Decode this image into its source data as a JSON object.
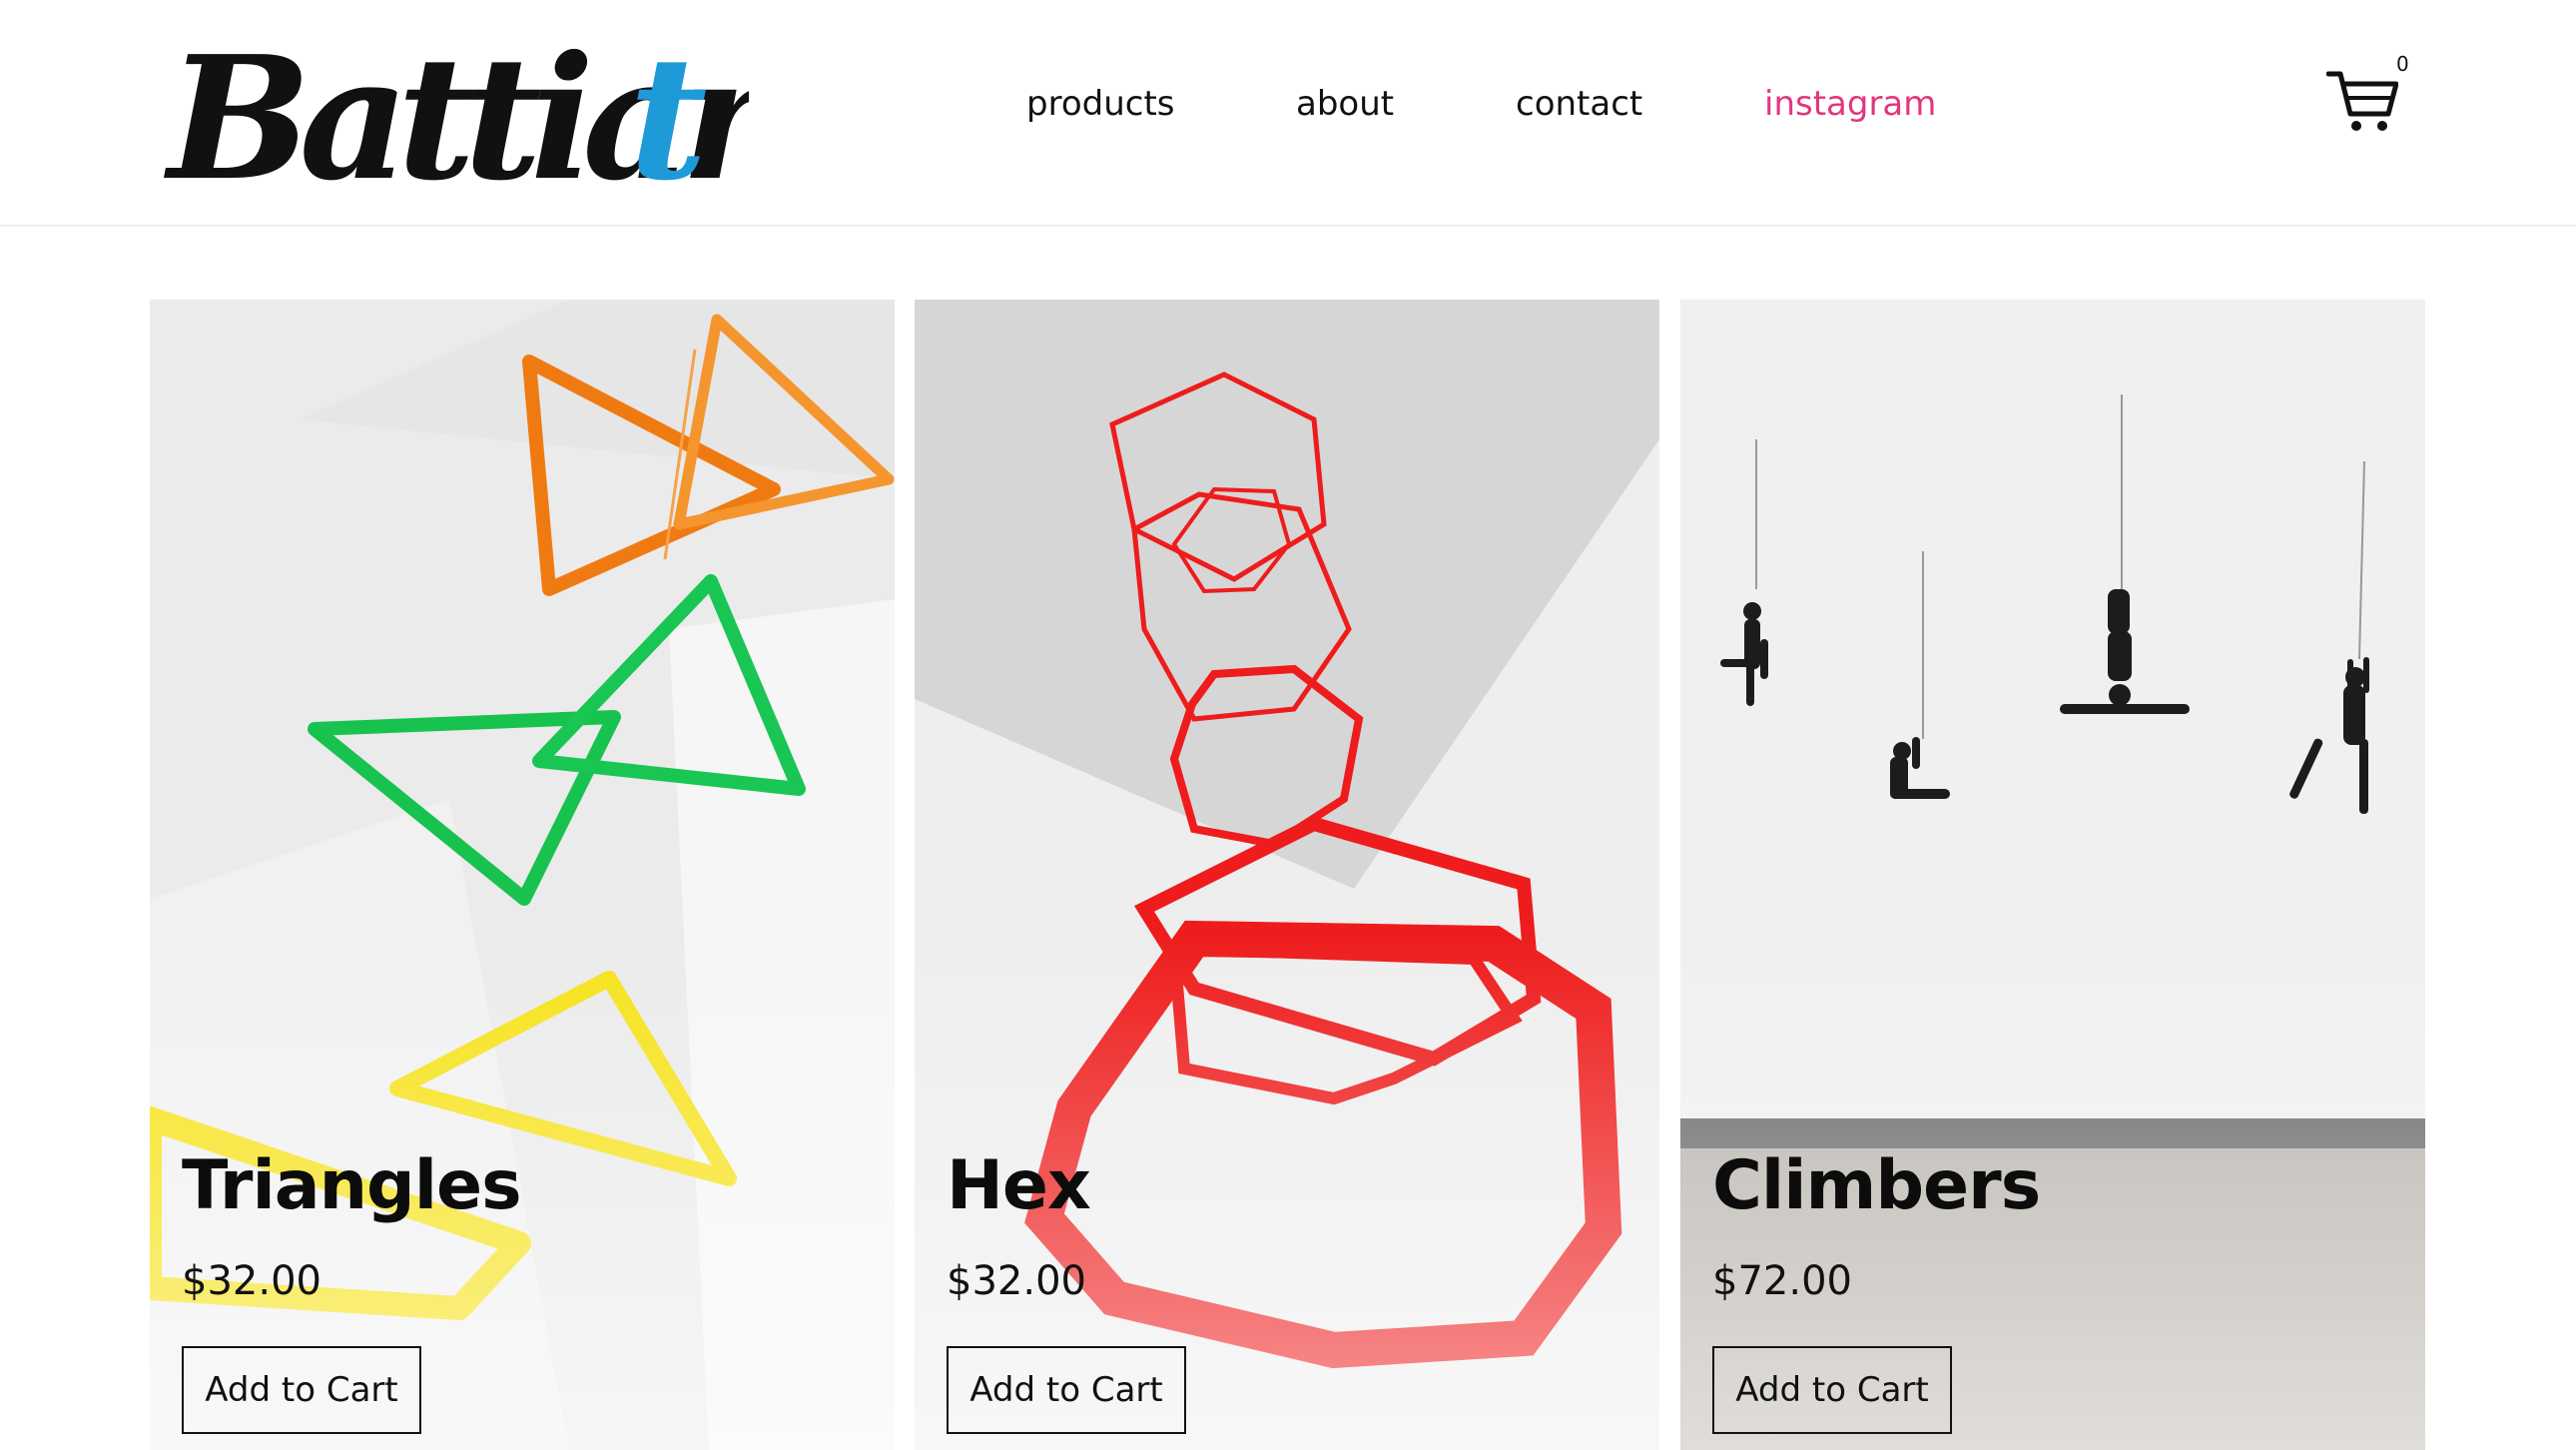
{
  "header": {
    "logo_text": "Battiart",
    "nav": [
      {
        "label": "products"
      },
      {
        "label": "about"
      },
      {
        "label": "contact"
      },
      {
        "label": "instagram"
      }
    ],
    "cart_count": "0",
    "accent_color": "#e2367f"
  },
  "products": [
    {
      "name": "Triangles",
      "price": "$32.00",
      "button": "Add to Cart"
    },
    {
      "name": "Hex",
      "price": "$32.00",
      "button": "Add to Cart"
    },
    {
      "name": "Climbers",
      "price": "$72.00",
      "button": "Add to Cart"
    }
  ],
  "colors": {
    "logo_black": "#111111",
    "logo_blue": "#1f9ad8",
    "orange": "#f07a12",
    "green": "#17c24e",
    "yellow": "#f6e21a",
    "red": "#ee1c1c"
  }
}
